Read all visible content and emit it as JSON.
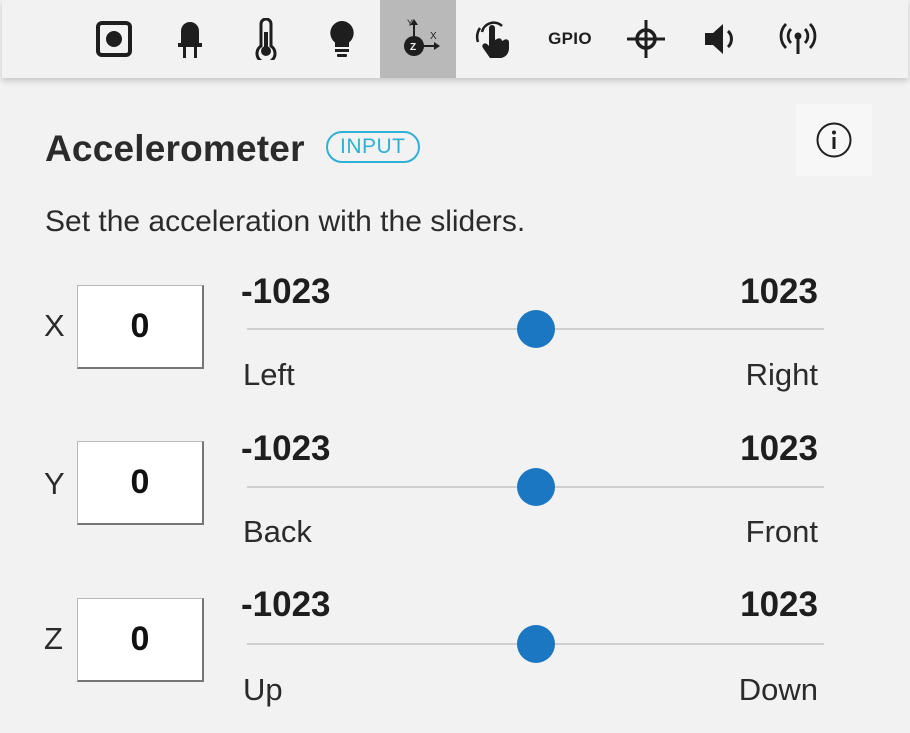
{
  "toolbar": {
    "gpio_label": "GPIO",
    "active_tool": "accelerometer",
    "accelerometer_icon_letters": {
      "y": "Y",
      "z": "Z",
      "x": "X"
    },
    "active_background": "#b9b9b9",
    "tools": [
      "button",
      "led",
      "thermometer",
      "light",
      "accelerometer",
      "touch",
      "gpio",
      "compass",
      "sound",
      "radio"
    ]
  },
  "panel": {
    "title": "Accelerometer",
    "badge": "INPUT",
    "description": "Set the acceleration with the sliders.",
    "info_icon": "info-icon"
  },
  "axes": [
    {
      "name": "X",
      "value": "0",
      "min": "-1023",
      "max": "1023",
      "min_label": "Left",
      "max_label": "Right",
      "fraction": 0.5
    },
    {
      "name": "Y",
      "value": "0",
      "min": "-1023",
      "max": "1023",
      "min_label": "Back",
      "max_label": "Front",
      "fraction": 0.5
    },
    {
      "name": "Z",
      "value": "0",
      "min": "-1023",
      "max": "1023",
      "min_label": "Up",
      "max_label": "Down",
      "fraction": 0.5
    }
  ],
  "colors": {
    "accent": "#1b77c2",
    "badge": "#2fb1d6",
    "background": "#f2f2f2"
  }
}
